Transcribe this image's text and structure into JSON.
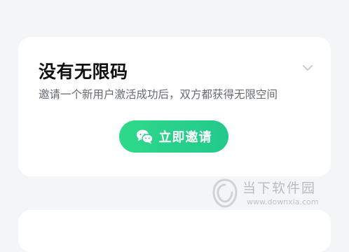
{
  "card": {
    "title": "没有无限码",
    "description": "邀请一个新用户激活成功后，双方都获得无限空间",
    "invite_button_label": "立即邀请"
  },
  "watermark": {
    "name": "当下软件园",
    "url": "www.downxia.com"
  },
  "colors": {
    "button_gradient_start": "#2fd98a",
    "button_gradient_end": "#22c98c",
    "page_background": "#f4f5f7",
    "card_background": "#ffffff"
  },
  "icons": {
    "collapse": "chevron-down-icon",
    "invite": "wechat-icon",
    "watermark": "downxia-logo"
  }
}
